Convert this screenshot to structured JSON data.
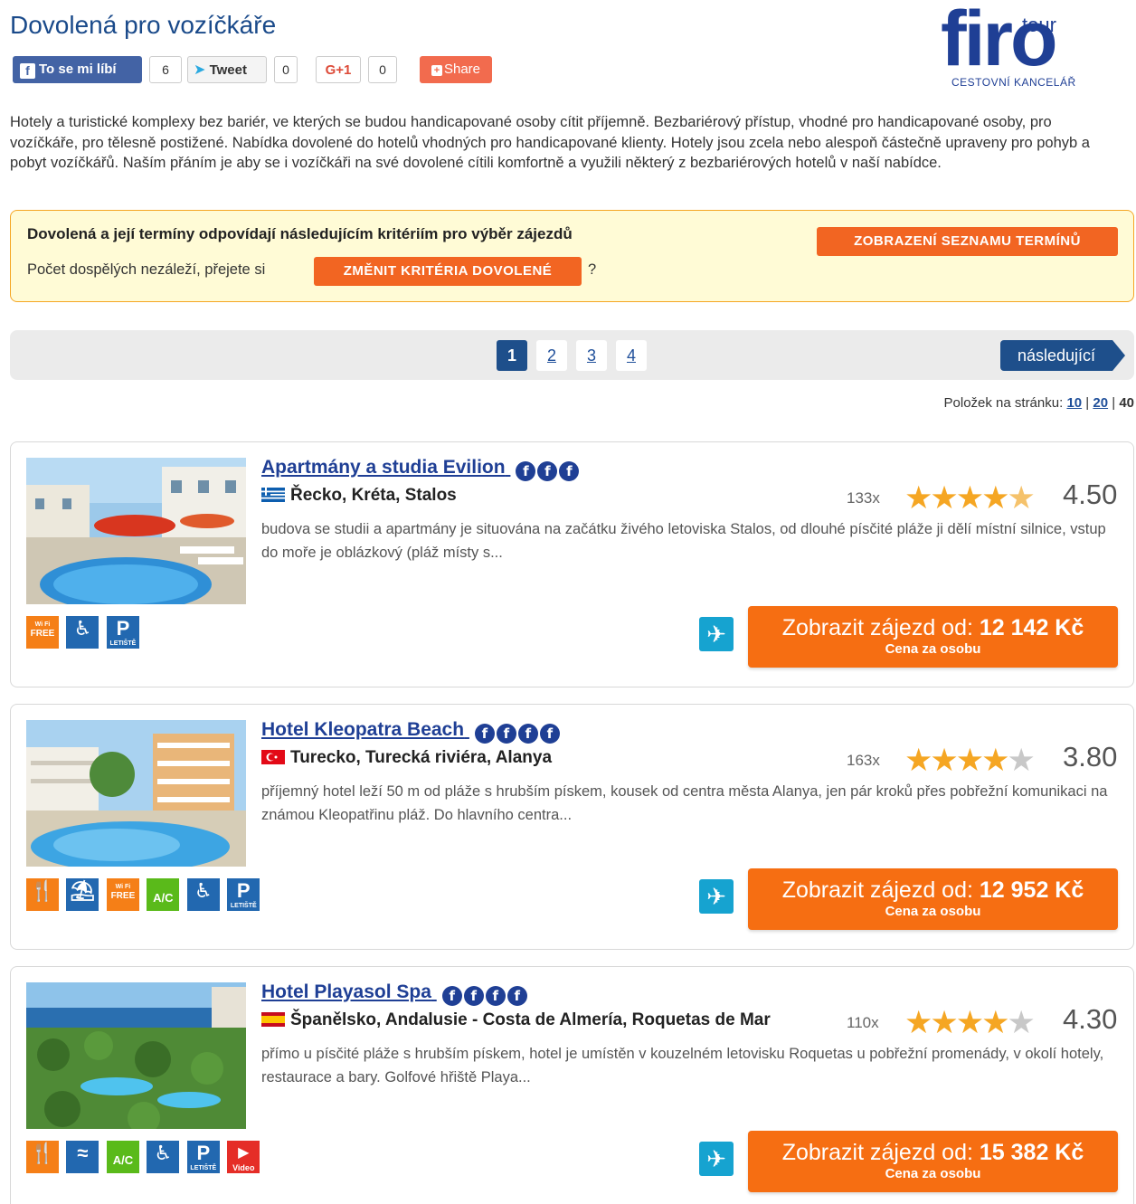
{
  "page": {
    "title": "Dovolená pro vozíčkáře"
  },
  "logo": {
    "main": "firo",
    "sup": "tour",
    "sub": "CESTOVNÍ KANCELÁŘ"
  },
  "social": {
    "facebook_label": "To se mi líbí",
    "facebook_count": "6",
    "tweet_label": "Tweet",
    "tweet_count": "0",
    "gplus_label": "G+1",
    "gplus_count": "0",
    "share_label": "Share"
  },
  "intro": "Hotely a turistické komplexy bez bariér, ve kterých se budou handicapované osoby cítit příjemně. Bezbariérový přístup, vhodné pro handicapované osoby, pro vozíčkáře, pro tělesně postižené. Nabídka dovolené do hotelů vhodných pro handicapované klienty. Hotely jsou zcela nebo alespoň částečně upraveny pro pohyb a pobyt vozíčkářů. Naším přáním je aby se i vozíčkáři na své dovolené cítili komfortně a využili některý z bezbariérových hotelů v naší nabídce.",
  "criteria": {
    "heading": "Dovolená a její termíny odpovídají následujícím kritériím pro výběr zájezdů",
    "adults_text": "Počet dospělých nezáleží, přejete si",
    "change_button": "ZMĚNIT KRITÉRIA DOVOLENÉ",
    "question_mark": "?",
    "list_button": "ZOBRAZENÍ SEZNAMU TERMÍNŮ"
  },
  "pagination": {
    "pages": [
      "1",
      "2",
      "3",
      "4"
    ],
    "active": "1",
    "next_label": "následující"
  },
  "per_page": {
    "label": "Položek na stránku:",
    "options": [
      "10",
      "20",
      "40"
    ],
    "separator": "|"
  },
  "colors": {
    "brand_blue": "#1f3f95",
    "cta_orange": "#f66e12",
    "star_gold": "#f5a623",
    "criteria_bg": "#fffbd6"
  },
  "hotels": [
    {
      "name": "Apartmány a studia Evilion",
      "category_marks": 3,
      "category_glyph": "f",
      "flag": "greece-flag-icon",
      "location": "Řecko, Kréta, Stalos",
      "reviews": "133x",
      "rating": "4.50",
      "stars_filled": 4.5,
      "description": "budova se studii a apartmány je situována na začátku živého letoviska Stalos, od dlouhé písčité pláže ji dělí místní silnice, vstup do moře je oblázkový (pláž místy s...",
      "amenities": [
        "wifi-free-icon",
        "wheelchair-icon",
        "parking-airport-icon"
      ],
      "cta_prefix": "Zobrazit zájezd od: ",
      "price": "12 142 Kč",
      "price_note": "Cena za osobu"
    },
    {
      "name": "Hotel Kleopatra Beach",
      "category_marks": 4,
      "category_glyph": "f",
      "flag": "turkey-flag-icon",
      "location": "Turecko, Turecká riviéra, Alanya",
      "reviews": "163x",
      "rating": "3.80",
      "stars_filled": 4,
      "description": "příjemný hotel leží 50 m od pláže s hrubším pískem, kousek od centra města Alanya, jen pár kroků přes pobřežní komunikaci na známou Kleopatřinu pláž. Do hlavního centra...",
      "amenities": [
        "restaurant-icon",
        "beach-icon",
        "wifi-free-icon",
        "air-conditioning-icon",
        "wheelchair-icon",
        "parking-airport-icon"
      ],
      "cta_prefix": "Zobrazit zájezd od: ",
      "price": "12 952 Kč",
      "price_note": "Cena za osobu"
    },
    {
      "name": "Hotel Playasol Spa",
      "category_marks": 4,
      "category_glyph": "f",
      "flag": "spain-flag-icon",
      "location": "Španělsko, Andalusie - Costa de Almería, Roquetas de Mar",
      "reviews": "110x",
      "rating": "4.30",
      "stars_filled": 4.3,
      "description": "přímo u písčité pláže s hrubším pískem, hotel je umístěn v kouzelném letovisku Roquetas u pobřežní promenády, v okolí hotely, restaurace a bary. Golfové hřiště Playa...",
      "amenities": [
        "restaurant-icon",
        "swimming-icon",
        "air-conditioning-icon",
        "wheelchair-icon",
        "parking-airport-icon",
        "video-icon"
      ],
      "cta_prefix": "Zobrazit zájezd od: ",
      "price": "15 382 Kč",
      "price_note": "Cena za osobu"
    }
  ],
  "amenity_labels": {
    "wifi_top": "Wi Fi",
    "wifi_bottom": "FREE",
    "parking": "P",
    "parking_sub": "LETIŠTĚ",
    "ac": "A/C",
    "video": "Video"
  }
}
